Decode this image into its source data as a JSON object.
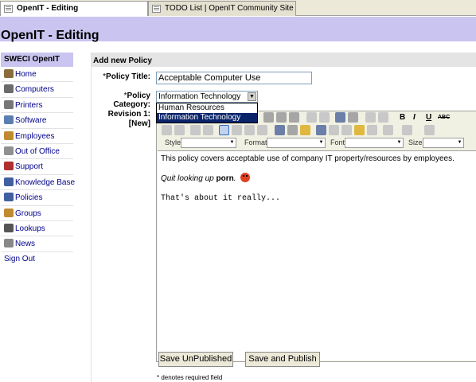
{
  "browser": {
    "tabs": [
      {
        "label": "OpenIT - Editing"
      },
      {
        "label": "TODO List | OpenIT Community Site"
      }
    ]
  },
  "header": {
    "title": "OpenIT - Editing"
  },
  "sidebar": {
    "title": "SWECI OpenIT",
    "items": [
      {
        "label": "Home",
        "icon": "house-icon",
        "color": "#8a6d3b"
      },
      {
        "label": "Computers",
        "icon": "computer-icon",
        "color": "#6b6b6b"
      },
      {
        "label": "Printers",
        "icon": "printer-icon",
        "color": "#777777"
      },
      {
        "label": "Software",
        "icon": "disc-icon",
        "color": "#5a7fb0"
      },
      {
        "label": "Employees",
        "icon": "people-icon",
        "color": "#c08a30"
      },
      {
        "label": "Out of Office",
        "icon": "airplane-icon",
        "color": "#909090"
      },
      {
        "label": "Support",
        "icon": "lifebuoy-icon",
        "color": "#b03030"
      },
      {
        "label": "Knowledge Base",
        "icon": "book-icon",
        "color": "#4060a0"
      },
      {
        "label": "Policies",
        "icon": "book-icon",
        "color": "#4060a0"
      },
      {
        "label": "Groups",
        "icon": "group-icon",
        "color": "#c08a30"
      },
      {
        "label": "Lookups",
        "icon": "binoculars-icon",
        "color": "#555555"
      },
      {
        "label": "News",
        "icon": "newspaper-icon",
        "color": "#888888"
      }
    ],
    "signout": "Sign Out"
  },
  "form": {
    "heading": "Add new Policy",
    "title_label": "Policy Title:",
    "title_value": "Acceptable Computer Use",
    "category_label": "Policy Category:",
    "category_value": "Information Technology",
    "category_options": [
      "Human Resources",
      "Information Technology"
    ],
    "revision_label": "Revision 1:",
    "revision_status": "[New]",
    "required_mark": "*"
  },
  "editor": {
    "style_label": "Style",
    "format_label": "Format",
    "font_label": "Font",
    "size_label": "Size",
    "bold": "B",
    "italic": "I",
    "underline": "U",
    "strike": "ABC",
    "para1": "This policy covers acceptable use of company IT property/resources by employees.",
    "para2_prefix": "Quit looking up",
    "para2_bold": "porn",
    "para2_suffix": ".",
    "para3": "That's about it really..."
  },
  "buttons": {
    "unpublished": "Save UnPublished",
    "publish": "Save and Publish"
  },
  "note": "* denotes required field"
}
